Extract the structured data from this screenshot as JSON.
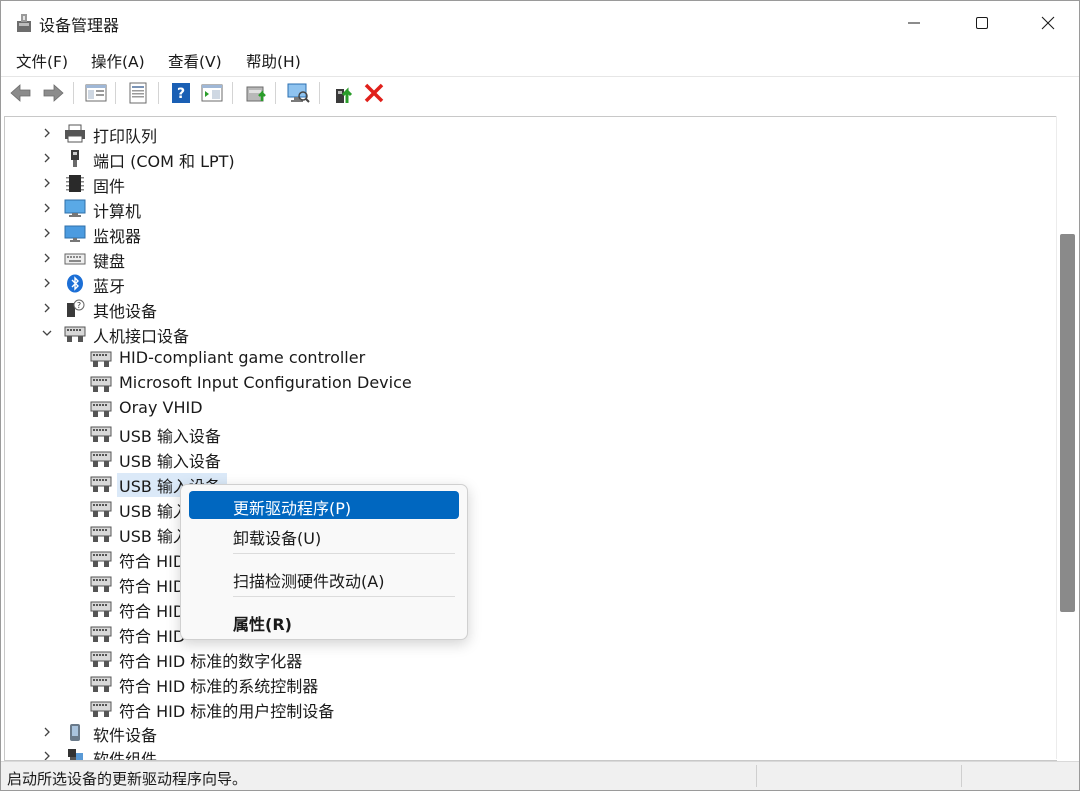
{
  "window": {
    "title": "设备管理器"
  },
  "menu": [
    "文件(F)",
    "操作(A)",
    "查看(V)",
    "帮助(H)"
  ],
  "toolbar": {
    "buttons": [
      "back-icon",
      "forward-icon",
      "show-hide-tree-icon",
      "properties-icon",
      "help-icon",
      "view-icon",
      "update-driver-icon",
      "scan-hardware-icon",
      "add-legacy-hardware-icon",
      "uninstall-device-icon"
    ],
    "accent_red": "#e0201b",
    "accent_green": "#2a9d2a",
    "accent_blue": "#1a5fb4"
  },
  "tree": {
    "categories_top": [
      {
        "label": "打印队列",
        "icon": "printer-icon",
        "expanded": false
      },
      {
        "label": "端口 (COM 和 LPT)",
        "icon": "port-icon",
        "expanded": false
      },
      {
        "label": "固件",
        "icon": "firmware-icon",
        "expanded": false
      },
      {
        "label": "计算机",
        "icon": "computer-icon",
        "expanded": false
      },
      {
        "label": "监视器",
        "icon": "monitor-icon",
        "expanded": false
      },
      {
        "label": "键盘",
        "icon": "keyboard-icon",
        "expanded": false
      },
      {
        "label": "蓝牙",
        "icon": "bluetooth-icon",
        "expanded": false
      },
      {
        "label": "其他设备",
        "icon": "other-device-icon",
        "expanded": false
      },
      {
        "label": "人机接口设备",
        "icon": "hid-icon",
        "expanded": true
      }
    ],
    "hid_children": [
      {
        "label": "HID-compliant game controller",
        "icon": "hid-device-icon"
      },
      {
        "label": "Microsoft Input Configuration Device",
        "icon": "hid-device-icon"
      },
      {
        "label": "Oray VHID",
        "icon": "hid-device-icon"
      },
      {
        "label": "USB 输入设备",
        "icon": "hid-device-icon"
      },
      {
        "label": "USB 输入设备",
        "icon": "hid-device-icon"
      },
      {
        "label": "USB 输入设备",
        "icon": "hid-device-icon",
        "selected": true
      },
      {
        "label": "USB 输入",
        "icon": "hid-device-icon"
      },
      {
        "label": "USB 输入",
        "icon": "hid-device-icon"
      },
      {
        "label": "符合 HID",
        "icon": "hid-device-icon"
      },
      {
        "label": "符合 HID",
        "icon": "hid-device-icon"
      },
      {
        "label": "符合 HID",
        "icon": "hid-device-icon"
      },
      {
        "label": "符合 HID",
        "icon": "hid-device-icon"
      },
      {
        "label": "符合 HID 标准的数字化器",
        "icon": "hid-device-icon"
      },
      {
        "label": "符合 HID 标准的系统控制器",
        "icon": "hid-device-icon"
      },
      {
        "label": "符合 HID 标准的用户控制设备",
        "icon": "hid-device-icon"
      }
    ],
    "categories_bottom": [
      {
        "label": "软件设备",
        "icon": "software-device-icon",
        "expanded": false
      },
      {
        "label": "软件组件",
        "icon": "software-component-icon",
        "expanded": false
      }
    ]
  },
  "context_menu": {
    "items": [
      {
        "label": "更新驱动程序(P)",
        "highlighted": true
      },
      {
        "label": "卸载设备(U)"
      },
      {
        "label": "扫描检测硬件改动(A)"
      },
      {
        "label": "属性(R)",
        "bold": true
      }
    ],
    "highlight_color": "#0067c0"
  },
  "status": {
    "text": "启动所选设备的更新驱动程序向导。"
  }
}
